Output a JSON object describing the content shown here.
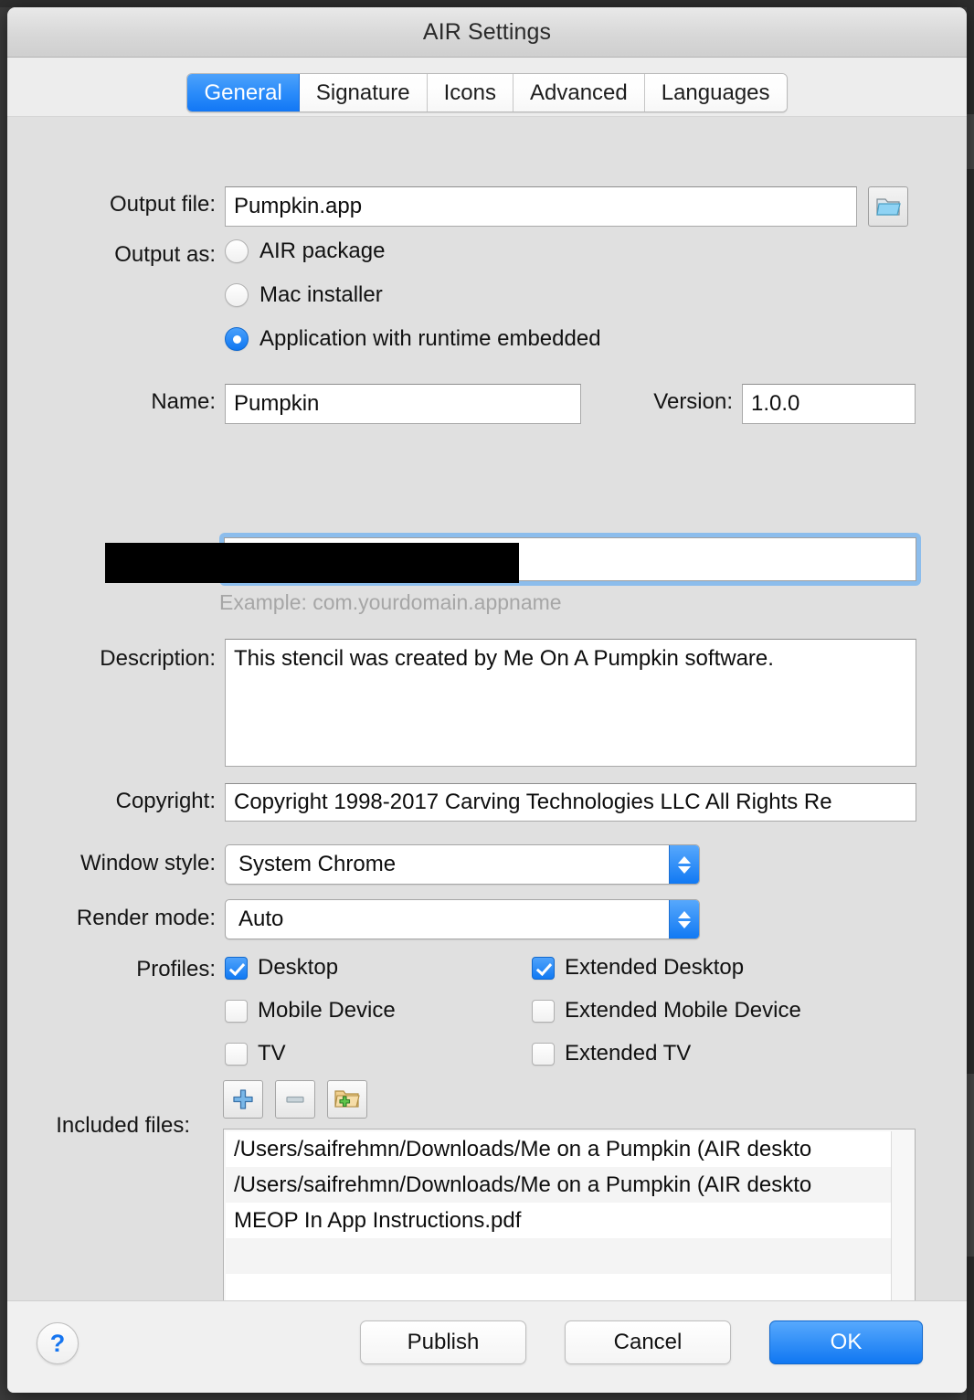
{
  "window": {
    "title": "AIR Settings"
  },
  "tabs": [
    {
      "label": "General",
      "active": true
    },
    {
      "label": "Signature",
      "active": false
    },
    {
      "label": "Icons",
      "active": false
    },
    {
      "label": "Advanced",
      "active": false
    },
    {
      "label": "Languages",
      "active": false
    }
  ],
  "form": {
    "output_file": {
      "label": "Output file:",
      "value": "Pumpkin.app",
      "browse_icon": "folder-icon"
    },
    "output_as": {
      "label": "Output as:",
      "options": [
        {
          "label": "AIR package",
          "selected": false
        },
        {
          "label": "Mac installer",
          "selected": false
        },
        {
          "label": "Application with runtime embedded",
          "selected": true
        }
      ]
    },
    "name": {
      "label": "Name:",
      "value": "Pumpkin"
    },
    "version": {
      "label": "Version:",
      "value": "1.0.0"
    },
    "app_id": {
      "value": "",
      "redacted": true,
      "hint": "Example: com.yourdomain.appname",
      "focused": true
    },
    "description": {
      "label": "Description:",
      "value": "This stencil was created by Me On A Pumpkin software."
    },
    "copyright": {
      "label": "Copyright:",
      "value": "Copyright 1998-2017 Carving Technologies LLC All Rights Re"
    },
    "window_style": {
      "label": "Window style:",
      "value": "System Chrome"
    },
    "render_mode": {
      "label": "Render mode:",
      "value": "Auto"
    },
    "profiles": {
      "label": "Profiles:",
      "left": [
        {
          "label": "Desktop",
          "checked": true
        },
        {
          "label": "Mobile Device",
          "checked": false
        },
        {
          "label": "TV",
          "checked": false
        }
      ],
      "right": [
        {
          "label": "Extended Desktop",
          "checked": true
        },
        {
          "label": "Extended Mobile Device",
          "checked": false
        },
        {
          "label": "Extended TV",
          "checked": false
        }
      ]
    },
    "included_files": {
      "label": "Included files:",
      "toolbar": [
        {
          "name": "add-file-button",
          "icon": "plus-icon",
          "enabled": true
        },
        {
          "name": "remove-file-button",
          "icon": "minus-icon",
          "enabled": false
        },
        {
          "name": "add-folder-button",
          "icon": "folder-add-icon",
          "enabled": true
        }
      ],
      "items": [
        "/Users/saifrehmn/Downloads/Me on a Pumpkin (AIR deskto",
        "/Users/saifrehmn/Downloads/Me on a Pumpkin (AIR deskto",
        "MEOP In App Instructions.pdf",
        "",
        "",
        ""
      ]
    }
  },
  "footer": {
    "help": "?",
    "publish": "Publish",
    "cancel": "Cancel",
    "ok": "OK"
  },
  "colors": {
    "accent_blue": "#1077f2",
    "window_bg": "#e0e0e0",
    "titlebar_bg": "#d8d8d8",
    "focus_ring": "#8cbdec",
    "redaction": "#000000"
  }
}
